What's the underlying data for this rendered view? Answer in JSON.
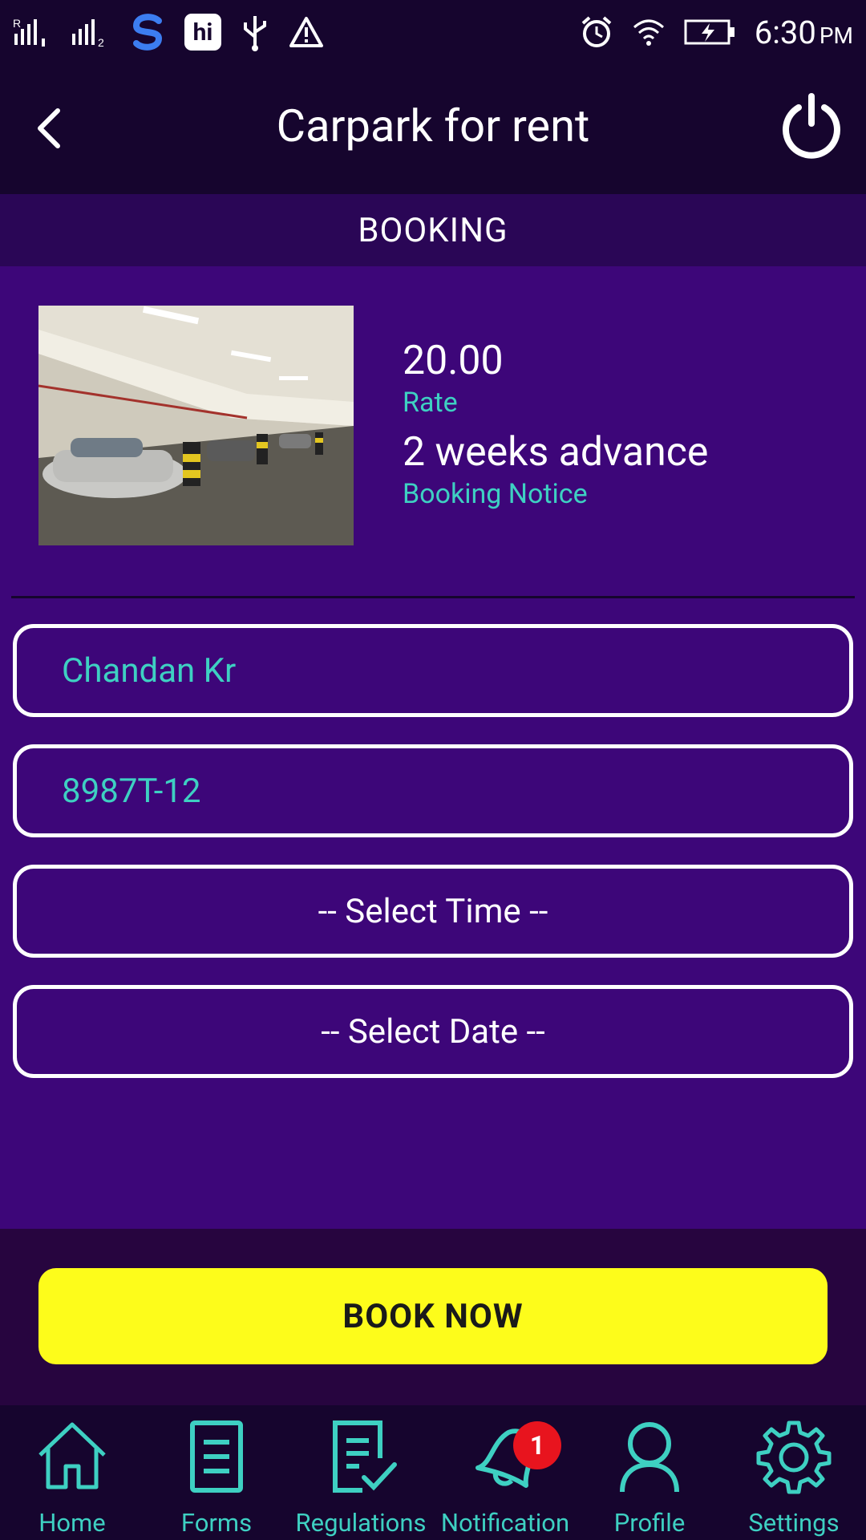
{
  "status_bar": {
    "time": "6:30",
    "ampm": "PM"
  },
  "app_bar": {
    "title": "Carpark for rent"
  },
  "section": {
    "title": "BOOKING"
  },
  "listing": {
    "rate_value": "20.00",
    "rate_label": "Rate",
    "notice_value": "2 weeks advance",
    "notice_label": "Booking Notice"
  },
  "form": {
    "name_value": "Chandan Kr",
    "vehicle_value": "8987T-12",
    "time_select": "-- Select Time --",
    "date_select": "-- Select Date --"
  },
  "book_button": {
    "label": "BOOK NOW"
  },
  "bottom_nav": {
    "items": [
      {
        "label": "Home",
        "icon": "home-icon"
      },
      {
        "label": "Forms",
        "icon": "forms-icon"
      },
      {
        "label": "Regulations",
        "icon": "regulations-icon"
      },
      {
        "label": "Notification",
        "icon": "bell-icon",
        "badge": "1"
      },
      {
        "label": "Profile",
        "icon": "profile-icon"
      },
      {
        "label": "Settings",
        "icon": "gear-icon"
      }
    ]
  },
  "colors": {
    "background": "#3d0679",
    "dark": "#16052e",
    "accent": "#3ed0c2",
    "button": "#fdfc1b",
    "badge": "#e8141e"
  }
}
